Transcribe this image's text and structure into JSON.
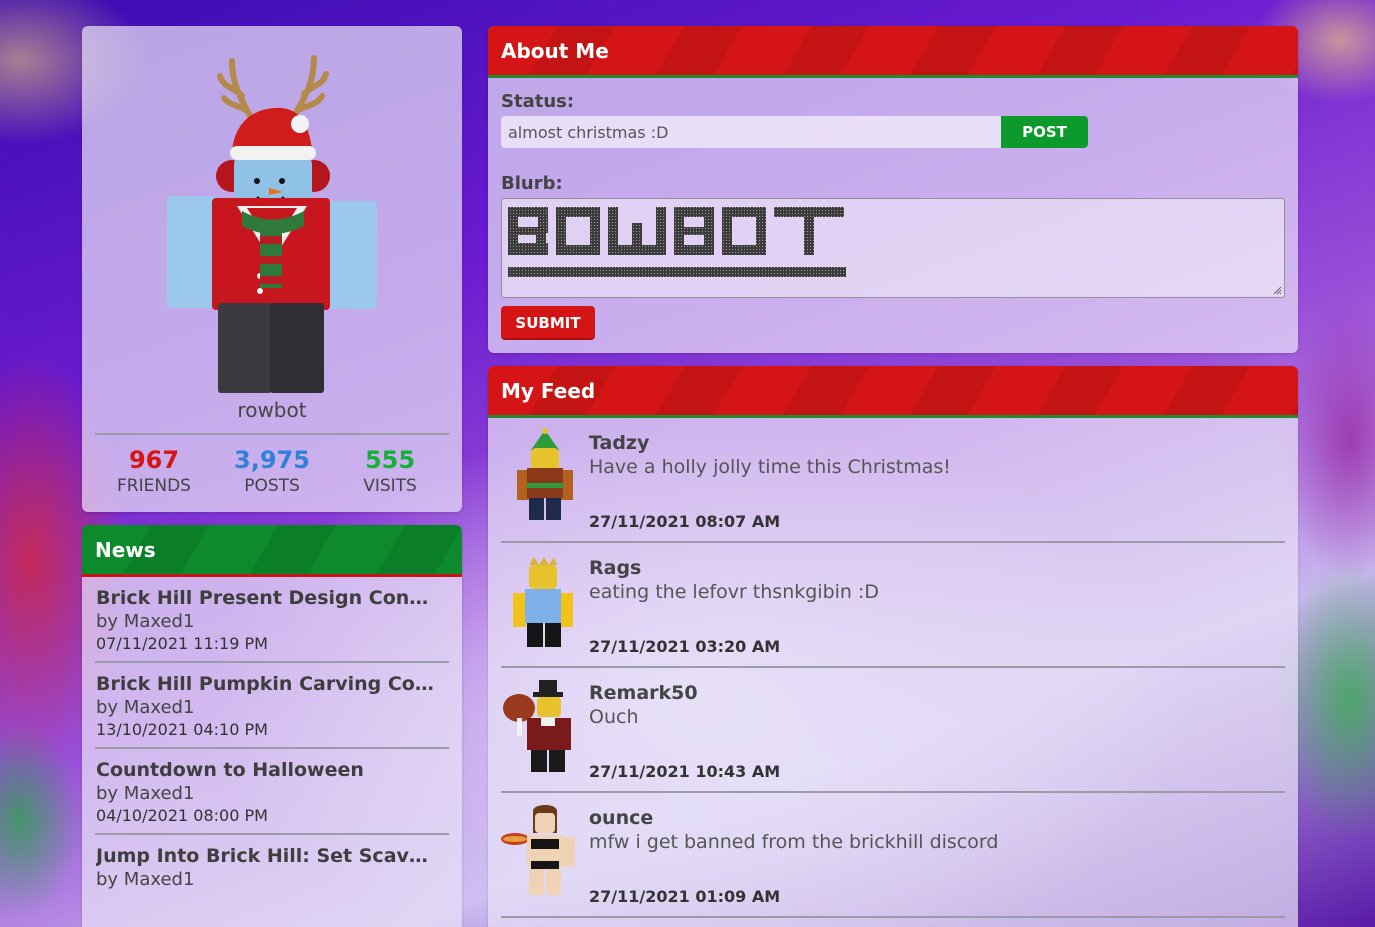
{
  "profile": {
    "username": "rowbot",
    "stats": [
      {
        "value": "967",
        "label": "FRIENDS",
        "color": "#d51515"
      },
      {
        "value": "3,975",
        "label": "POSTS",
        "color": "#2f82d6"
      },
      {
        "value": "555",
        "label": "VISITS",
        "color": "#13b13a"
      }
    ]
  },
  "news": {
    "title": "News",
    "items": [
      {
        "title": "Brick Hill Present Design Conte...",
        "author": "by Maxed1",
        "date": "07/11/2021 11:19 PM"
      },
      {
        "title": "Brick Hill Pumpkin Carving Co...",
        "author": "by Maxed1",
        "date": "13/10/2021 04:10 PM"
      },
      {
        "title": "Countdown to Halloween",
        "author": "by Maxed1",
        "date": "04/10/2021 08:00 PM"
      },
      {
        "title": "Jump Into Brick Hill: Set Scave...",
        "author": "by Maxed1",
        "date": ""
      }
    ]
  },
  "about": {
    "title": "About Me",
    "status_label": "Status:",
    "status_value": "almost christmas :D",
    "post_label": "POST",
    "blurb_label": "Blurb:",
    "blurb_text": "ROWBOT",
    "submit_label": "SUBMIT"
  },
  "feed": {
    "title": "My Feed",
    "items": [
      {
        "name": "Tadzy",
        "text": "Have a holly jolly time this Christmas!",
        "date": "27/11/2021 08:07 AM",
        "avatar": "elf-avatar"
      },
      {
        "name": "Rags",
        "text": "eating the lefovr thsnkgibin :D",
        "date": "27/11/2021 03:20 AM",
        "avatar": "crown-avatar"
      },
      {
        "name": "Remark50",
        "text": "Ouch",
        "date": "27/11/2021 10:43 AM",
        "avatar": "pilgrim-avatar"
      },
      {
        "name": "ounce",
        "text": "mfw i get banned from the brickhill discord",
        "date": "27/11/2021 01:09 AM",
        "avatar": "hotdog-avatar"
      }
    ]
  },
  "colors": {
    "red": "#d51515",
    "green": "#0c8a2c",
    "post_green": "#0c9a2c"
  }
}
